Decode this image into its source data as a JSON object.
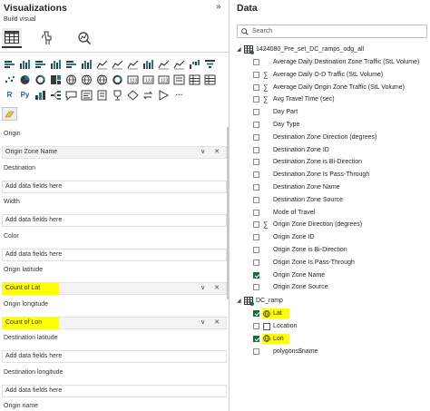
{
  "viz": {
    "title": "Visualizations",
    "collapse_glyph": "»",
    "build_label": "Build visual",
    "tabs": [
      {
        "name": "build-visual-tab",
        "icon": "table-grid-icon",
        "active": true
      },
      {
        "name": "format-visual-tab",
        "icon": "paintbrush-hand-icon",
        "active": false
      },
      {
        "name": "analytics-tab",
        "icon": "magnify-chart-icon",
        "active": false
      }
    ],
    "gallery_rows": [
      [
        "stacked-bar-icon",
        "stacked-column-icon",
        "clustered-bar-icon",
        "clustered-column-icon",
        "100-bar-icon",
        "100-column-icon",
        "line-chart-icon",
        "area-chart-icon",
        "stacked-area-icon",
        "line-column-icon",
        "line-clustered-icon",
        "ribbon-chart-icon",
        "waterfall-icon",
        "funnel-icon"
      ],
      [
        "scatter-icon",
        "pie-chart-icon",
        "donut-icon",
        "treemap-icon",
        "map-icon",
        "filled-map-icon",
        "azure-map-icon",
        "gauge-icon",
        "card-icon",
        "multirow-card-icon",
        "kpi-icon",
        "slicer-icon",
        "table-icon",
        "matrix-icon"
      ],
      [
        "r-visual-icon",
        "python-visual-icon",
        "key-influencers-icon",
        "decomp-tree-icon",
        "qa-icon",
        "smart-narrative-icon",
        "paginated-icon",
        "trophy-icon",
        "diamond-icon",
        "arrows-icon",
        "power-apps-icon",
        "more-visuals-icon"
      ]
    ],
    "r_glyph": "R",
    "py_glyph": "Py",
    "more_glyph": "···",
    "wells": [
      {
        "label": "Origin",
        "value": "Origin Zone Name",
        "filled": true,
        "highlight": false
      },
      {
        "label": "Destination",
        "value": "Add data fields here",
        "filled": false,
        "highlight": false
      },
      {
        "label": "Width",
        "value": "Add data fields here",
        "filled": false,
        "highlight": false
      },
      {
        "label": "Color",
        "value": "Add data fields here",
        "filled": false,
        "highlight": false
      },
      {
        "label": "Origin latitude",
        "value": "Count of Lat",
        "filled": true,
        "highlight": true
      },
      {
        "label": "Origin longitude",
        "value": "Count of Lon",
        "filled": true,
        "highlight": true
      },
      {
        "label": "Destination latitude",
        "value": "Add data fields here",
        "filled": false,
        "highlight": false
      },
      {
        "label": "Destination longitude",
        "value": "Add data fields here",
        "filled": false,
        "highlight": false
      },
      {
        "label": "Origin name",
        "value": "",
        "filled": false,
        "highlight": false
      }
    ],
    "well_actions": "∨ ✕",
    "highlight_color": "#ffff00"
  },
  "data": {
    "title": "Data",
    "search_placeholder": "Search",
    "tables": [
      {
        "name": "1424080_Pre_set_DC_ramps_odg_all",
        "expanded": true,
        "fields": [
          {
            "label": "Average Daily Destination Zone Traffic (StL Volume)",
            "sigma": false,
            "checked": false
          },
          {
            "label": "Average Daily O-D Traffic (StL Volume)",
            "sigma": true,
            "checked": false
          },
          {
            "label": "Average Daily Origin Zone Traffic (StL Volume)",
            "sigma": true,
            "checked": false
          },
          {
            "label": "Avg Travel Time (sec)",
            "sigma": true,
            "checked": false
          },
          {
            "label": "Day Part",
            "sigma": false,
            "checked": false
          },
          {
            "label": "Day Type",
            "sigma": false,
            "checked": false
          },
          {
            "label": "Destination Zone Direction (degrees)",
            "sigma": false,
            "checked": false
          },
          {
            "label": "Destination Zone ID",
            "sigma": false,
            "checked": false
          },
          {
            "label": "Destination Zone is Bi-Direction",
            "sigma": false,
            "checked": false
          },
          {
            "label": "Destination Zone Is Pass-Through",
            "sigma": false,
            "checked": false
          },
          {
            "label": "Destination Zone Name",
            "sigma": false,
            "checked": false
          },
          {
            "label": "Destination Zone Source",
            "sigma": false,
            "checked": false
          },
          {
            "label": "Mode of Travel",
            "sigma": false,
            "checked": false
          },
          {
            "label": "Origin Zone Direction (degrees)",
            "sigma": true,
            "checked": false
          },
          {
            "label": "Origin Zone ID",
            "sigma": false,
            "checked": false
          },
          {
            "label": "Origin Zone is Bi-Direction",
            "sigma": false,
            "checked": false
          },
          {
            "label": "Origin Zone Is Pass-Through",
            "sigma": false,
            "checked": false
          },
          {
            "label": "Origin Zone Name",
            "sigma": false,
            "checked": true
          },
          {
            "label": "Origin Zone Source",
            "sigma": false,
            "checked": false
          }
        ]
      },
      {
        "name": "DC_ramp",
        "expanded": true,
        "fields": [
          {
            "label": "Lat",
            "icon": "globe-icon",
            "checked": true,
            "highlight": true
          },
          {
            "label": "Location",
            "icon": "location-table-icon",
            "checked": false,
            "highlight": false
          },
          {
            "label": "Lon",
            "icon": "globe-icon",
            "checked": true,
            "highlight": true
          },
          {
            "label": "polygons$name",
            "icon": "",
            "checked": false,
            "highlight": false
          }
        ]
      }
    ],
    "sigma_glyph": "∑",
    "expand_glyph": "◢"
  }
}
